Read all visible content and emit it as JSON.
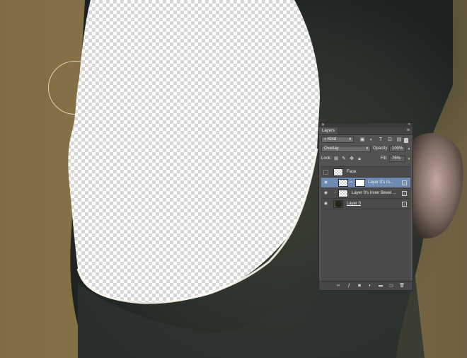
{
  "panel": {
    "title": "Layers",
    "filter_kind": "Kind",
    "blend_mode": "Overlay",
    "opacity_label": "Opacity:",
    "opacity_value": "100%",
    "lock_label": "Lock:",
    "fill_label": "Fill:",
    "fill_value": "75%"
  },
  "layers": [
    {
      "name": "Face",
      "visible": false,
      "selected": false
    },
    {
      "name": "Layer 0's In...",
      "visible": true,
      "selected": true
    },
    {
      "name": "Layer 0's Inner Bevel ...",
      "visible": true,
      "selected": false
    },
    {
      "name": "Layer 0",
      "visible": true,
      "selected": false
    }
  ],
  "icons": {
    "filter": [
      "image-filter-icon",
      "adjustment-filter-icon",
      "type-filter-icon",
      "shape-filter-icon",
      "smart-object-filter-icon",
      "filter-toggle-icon"
    ],
    "lock": [
      "lock-transparent-icon",
      "lock-image-icon",
      "lock-position-icon",
      "lock-all-icon"
    ],
    "footer": [
      "link-layers-icon",
      "fx-icon",
      "add-mask-icon",
      "adjustment-layer-icon",
      "group-folder-icon",
      "new-layer-icon",
      "trash-icon"
    ]
  }
}
